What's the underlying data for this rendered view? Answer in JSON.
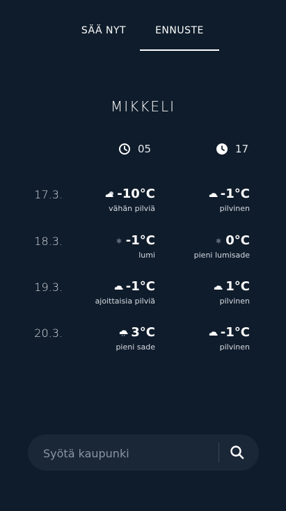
{
  "tabs": {
    "now_label": "SÄÄ NYT",
    "forecast_label": "ENNUSTE",
    "active": "forecast"
  },
  "city": "MIKKELI",
  "time_columns": [
    {
      "label": "05",
      "icon": "clock-outline-icon"
    },
    {
      "label": "17",
      "icon": "clock-filled-icon"
    }
  ],
  "forecast": [
    {
      "date": "17.3.",
      "early": {
        "temp": "-10°C",
        "desc": "vähän pilviä",
        "icon": "partly-cloudy-icon"
      },
      "late": {
        "temp": "-1°C",
        "desc": "pilvinen",
        "icon": "cloud-icon"
      }
    },
    {
      "date": "18.3.",
      "early": {
        "temp": "-1°C",
        "desc": "lumi",
        "icon": "snow-icon"
      },
      "late": {
        "temp": "0°C",
        "desc": "pieni lumisade",
        "icon": "snow-icon"
      }
    },
    {
      "date": "19.3.",
      "early": {
        "temp": "-1°C",
        "desc": "ajoittaisia pilviä",
        "icon": "cloud-icon"
      },
      "late": {
        "temp": "1°C",
        "desc": "pilvinen",
        "icon": "cloud-icon"
      }
    },
    {
      "date": "20.3.",
      "early": {
        "temp": "3°C",
        "desc": "pieni sade",
        "icon": "rain-cloud-icon"
      },
      "late": {
        "temp": "-1°C",
        "desc": "pilvinen",
        "icon": "cloud-icon"
      }
    }
  ],
  "search": {
    "placeholder": "Syötä kaupunki",
    "value": "",
    "icon": "search-icon"
  },
  "colors": {
    "background": "#0f1c2b",
    "search_background": "#1a2736",
    "text": "#ffffff",
    "placeholder": "#8a94a1"
  }
}
